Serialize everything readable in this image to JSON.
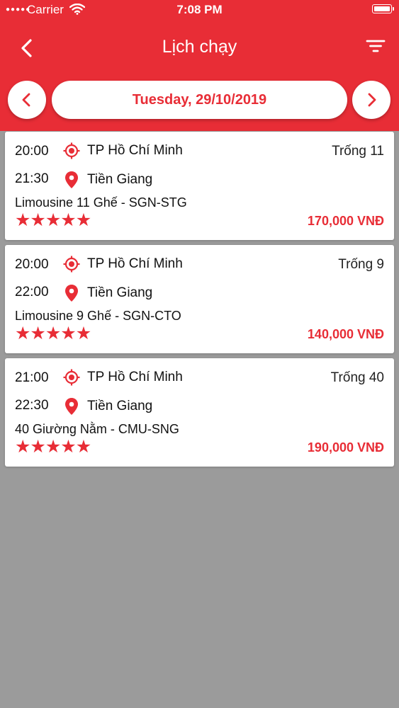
{
  "status_bar": {
    "carrier": "Carrier",
    "time": "7:08 PM"
  },
  "nav": {
    "title": "Lịch chạy"
  },
  "date_picker": {
    "date": "Tuesday, 29/10/2019"
  },
  "colors": {
    "accent": "#e82d36",
    "background": "#9b9b9b",
    "card": "#ffffff"
  },
  "icons": {
    "back": "chevron-left-icon",
    "filter": "filter-icon",
    "prev": "chevron-left-icon",
    "next": "chevron-right-icon",
    "origin": "target-icon",
    "destination": "map-pin-icon",
    "rating": "star-icon"
  },
  "trips": [
    {
      "depart": "20:00",
      "arrive": "21:30",
      "origin": "TP Hồ Chí Minh",
      "destination": "Tiền Giang",
      "seats": "Trống 11",
      "route": "Limousine 11 Ghế - SGN-STG",
      "rating": 5,
      "price": "170,000 VNĐ"
    },
    {
      "depart": "20:00",
      "arrive": "22:00",
      "origin": "TP Hồ Chí Minh",
      "destination": "Tiền Giang",
      "seats": "Trống 9",
      "route": "Limousine 9 Ghế - SGN-CTO",
      "rating": 5,
      "price": "140,000 VNĐ"
    },
    {
      "depart": "21:00",
      "arrive": "22:30",
      "origin": "TP Hồ Chí Minh",
      "destination": "Tiền Giang",
      "seats": "Trống 40",
      "route": "40 Giường Nằm - CMU-SNG",
      "rating": 5,
      "price": "190,000 VNĐ"
    }
  ]
}
